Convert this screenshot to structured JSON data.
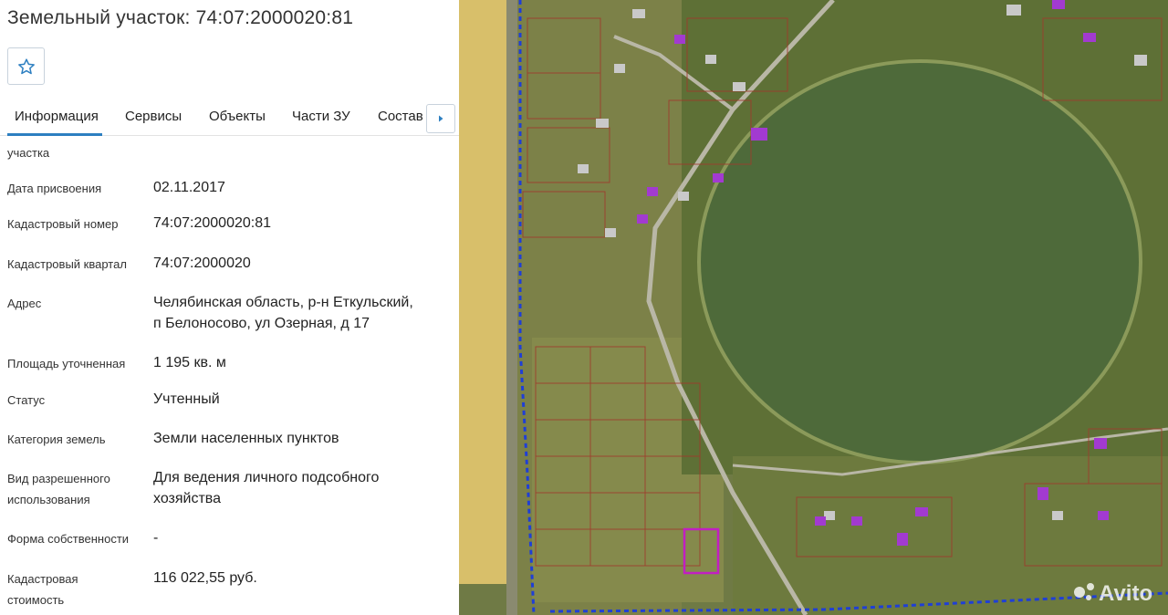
{
  "title": "Земельный участок: 74:07:2000020:81",
  "tabs": [
    "Информация",
    "Сервисы",
    "Объекты",
    "Части ЗУ",
    "Состав"
  ],
  "fields": {
    "area_type": {
      "label_partial": "участка"
    },
    "date": {
      "label": "Дата присвоения",
      "value": "02.11.2017"
    },
    "cad_num": {
      "label": "Кадастровый номер",
      "value": "74:07:2000020:81"
    },
    "cad_q": {
      "label": "Кадастровый квартал",
      "value": "74:07:2000020"
    },
    "address": {
      "label": "Адрес",
      "value_line1": "Челябинская область, р-н Еткульский,",
      "value_line2": "п Белоносово, ул Озерная, д 17"
    },
    "area": {
      "label": "Площадь уточненная",
      "value": "1 195 кв. м"
    },
    "status": {
      "label": "Статус",
      "value": "Учтенный"
    },
    "category": {
      "label": "Категория земель",
      "value": "Земли населенных пунктов"
    },
    "usage": {
      "label_line1": "Вид разрешенного",
      "label_line2": "использования",
      "value_line1": "Для ведения личного подсобного",
      "value_line2": "хозяйства"
    },
    "ownership": {
      "label": "Форма собственности",
      "value": "-"
    },
    "cost": {
      "label_line1": "Кадастровая",
      "label_line2": "стоимость",
      "value": "116 022,55 руб."
    }
  },
  "watermark": "Avito",
  "colors": {
    "accent": "#2d7fc1",
    "parcel": "#c21ec2",
    "boundary": "#1f3fd6",
    "water": "#4e6a3a"
  },
  "icons": {
    "favorite": "star-outline",
    "tabs_next": "chevron-right"
  }
}
